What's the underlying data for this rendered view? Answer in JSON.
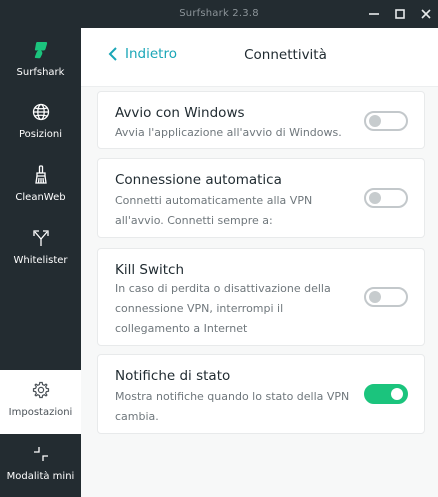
{
  "window": {
    "title": "Surfshark 2.3.8"
  },
  "sidebar": {
    "items": [
      {
        "id": "surfshark",
        "label": "Surfshark",
        "icon": "surfshark-logo-icon"
      },
      {
        "id": "posizioni",
        "label": "Posizioni",
        "icon": "globe-icon"
      },
      {
        "id": "cleanweb",
        "label": "CleanWeb",
        "icon": "brush-icon"
      },
      {
        "id": "whitelister",
        "label": "Whitelister",
        "icon": "split-arrows-icon"
      },
      {
        "id": "impostazioni",
        "label": "Impostazioni",
        "icon": "gear-icon",
        "selected": true
      },
      {
        "id": "mini",
        "label": "Modalità mini",
        "icon": "minimize-arrows-icon"
      }
    ]
  },
  "header": {
    "back_label": "Indietro",
    "title": "Connettività"
  },
  "settings": [
    {
      "title": "Avvio con Windows",
      "lines": [
        "Avvia l'applicazione all'avvio di Windows."
      ],
      "enabled": false
    },
    {
      "title": "Connessione automatica",
      "lines": [
        "Connetti automaticamente alla VPN",
        "all'avvio. Connetti sempre a:"
      ],
      "enabled": false
    },
    {
      "title": "Kill Switch",
      "lines": [
        "In caso di perdita o disattivazione della",
        "connessione VPN, interrompi il",
        "collegamento a Internet"
      ],
      "enabled": false
    },
    {
      "title": "Notifiche di stato",
      "lines": [
        "Mostra notifiche quando lo stato della VPN",
        "cambia."
      ],
      "enabled": true
    }
  ],
  "colors": {
    "sidebar_bg": "#232c31",
    "accent": "#1aa6b7",
    "logo_green": "#1bc47d",
    "toggle_on": "#1bc47d"
  }
}
